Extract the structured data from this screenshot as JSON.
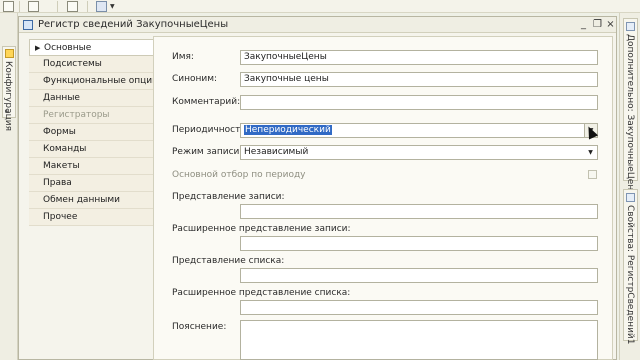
{
  "window": {
    "title": "Регистр сведений ЗакупочныеЦены",
    "minimize_icon": "minimize-icon",
    "maximize_icon": "maximize-icon",
    "close_icon": "close-icon"
  },
  "left_sidebar": {
    "tab_label": "Конфигурация"
  },
  "right_sidebar": {
    "tab1_label": "Дополнительно: ЗакупочныеЦены",
    "tab2_label": "Свойства: РегистрСведений1"
  },
  "nav": {
    "items": [
      {
        "label": "Основные",
        "state": "active"
      },
      {
        "label": "Подсистемы",
        "state": "normal"
      },
      {
        "label": "Функциональные опции",
        "state": "normal"
      },
      {
        "label": "Данные",
        "state": "normal"
      },
      {
        "label": "Регистраторы",
        "state": "disabled"
      },
      {
        "label": "Формы",
        "state": "normal"
      },
      {
        "label": "Команды",
        "state": "normal"
      },
      {
        "label": "Макеты",
        "state": "normal"
      },
      {
        "label": "Права",
        "state": "normal"
      },
      {
        "label": "Обмен данными",
        "state": "normal"
      },
      {
        "label": "Прочее",
        "state": "normal"
      }
    ]
  },
  "form": {
    "name_label": "Имя:",
    "name_value": "ЗакупочныеЦены",
    "synonym_label": "Синоним:",
    "synonym_value": "Закупочные цены",
    "comment_label": "Комментарий:",
    "comment_value": "",
    "periodicity_label": "Периодичность:",
    "periodicity_value": "Непериодический",
    "write_mode_label": "Режим записи:",
    "write_mode_value": "Независимый",
    "main_filter_label": "Основной отбор по периоду",
    "main_filter_checked": false,
    "record_presentation_label": "Представление записи:",
    "record_presentation_value": "",
    "extended_record_presentation_label": "Расширенное представление записи:",
    "extended_record_presentation_value": "",
    "list_presentation_label": "Представление списка:",
    "list_presentation_value": "",
    "extended_list_presentation_label": "Расширенное представление списка:",
    "extended_list_presentation_value": "",
    "explanation_label": "Пояснение:",
    "explanation_value": ""
  },
  "colors": {
    "selection": "#316ac5",
    "panel_bg": "#f5f4ec",
    "nav_bg": "#f3efe2"
  }
}
